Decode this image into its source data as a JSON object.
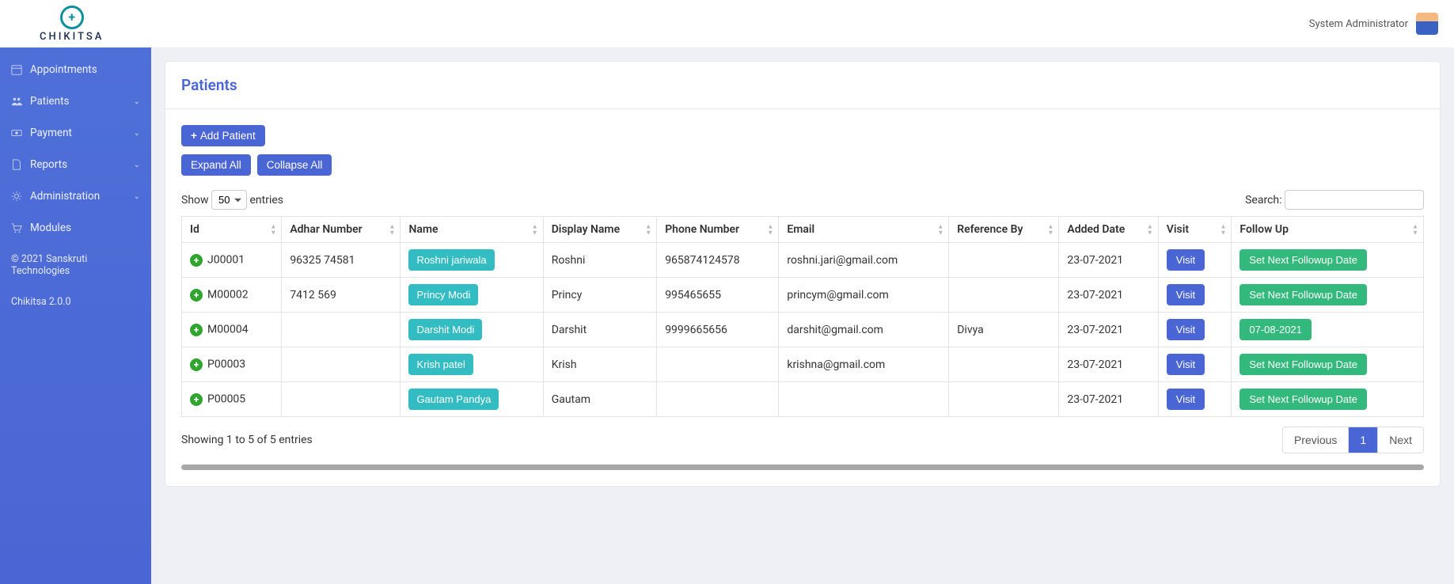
{
  "brand": {
    "logo_text": "CHIKITSA"
  },
  "user": {
    "name": "System Administrator"
  },
  "sidebar": {
    "items": [
      {
        "label": "Appointments",
        "has_sub": false,
        "icon": "calendar"
      },
      {
        "label": "Patients",
        "has_sub": true,
        "icon": "users"
      },
      {
        "label": "Payment",
        "has_sub": true,
        "icon": "money"
      },
      {
        "label": "Reports",
        "has_sub": true,
        "icon": "document"
      },
      {
        "label": "Administration",
        "has_sub": true,
        "icon": "gear"
      },
      {
        "label": "Modules",
        "has_sub": false,
        "icon": "cart"
      }
    ],
    "copyright": "© 2021 Sanskruti Technologies",
    "version": "Chikitsa 2.0.0"
  },
  "page": {
    "title": "Patients",
    "add_button": "Add Patient",
    "expand_all": "Expand All",
    "collapse_all": "Collapse All"
  },
  "table_controls": {
    "show_label": "Show",
    "entries_label": "entries",
    "entries_value": "50",
    "search_label": "Search:"
  },
  "table": {
    "headers": [
      "Id",
      "Adhar Number",
      "Name",
      "Display Name",
      "Phone Number",
      "Email",
      "Reference By",
      "Added Date",
      "Visit",
      "Follow Up"
    ],
    "visit_label": "Visit",
    "followup_default": "Set Next Followup Date",
    "rows": [
      {
        "id": "J00001",
        "adhar": "96325 74581",
        "name": "Roshni jariwala",
        "display": "Roshni",
        "phone": "965874124578",
        "email": "roshni.jari@gmail.com",
        "ref": "",
        "added": "23-07-2021",
        "followup": "Set Next Followup Date"
      },
      {
        "id": "M00002",
        "adhar": "7412 569",
        "name": "Princy Modi",
        "display": "Princy",
        "phone": "995465655",
        "email": "princym@gmail.com",
        "ref": "",
        "added": "23-07-2021",
        "followup": "Set Next Followup Date"
      },
      {
        "id": "M00004",
        "adhar": "",
        "name": "Darshit Modi",
        "display": "Darshit",
        "phone": "9999665656",
        "email": "darshit@gmail.com",
        "ref": "Divya",
        "added": "23-07-2021",
        "followup": "07-08-2021"
      },
      {
        "id": "P00003",
        "adhar": "",
        "name": "Krish patel",
        "display": "Krish",
        "phone": "",
        "email": "krishna@gmail.com",
        "ref": "",
        "added": "23-07-2021",
        "followup": "Set Next Followup Date"
      },
      {
        "id": "P00005",
        "adhar": "",
        "name": "Gautam Pandya",
        "display": "Gautam",
        "phone": "",
        "email": "",
        "ref": "",
        "added": "23-07-2021",
        "followup": "Set Next Followup Date"
      }
    ]
  },
  "table_footer": {
    "info": "Showing 1 to 5 of 5 entries",
    "previous": "Previous",
    "page": "1",
    "next": "Next"
  }
}
